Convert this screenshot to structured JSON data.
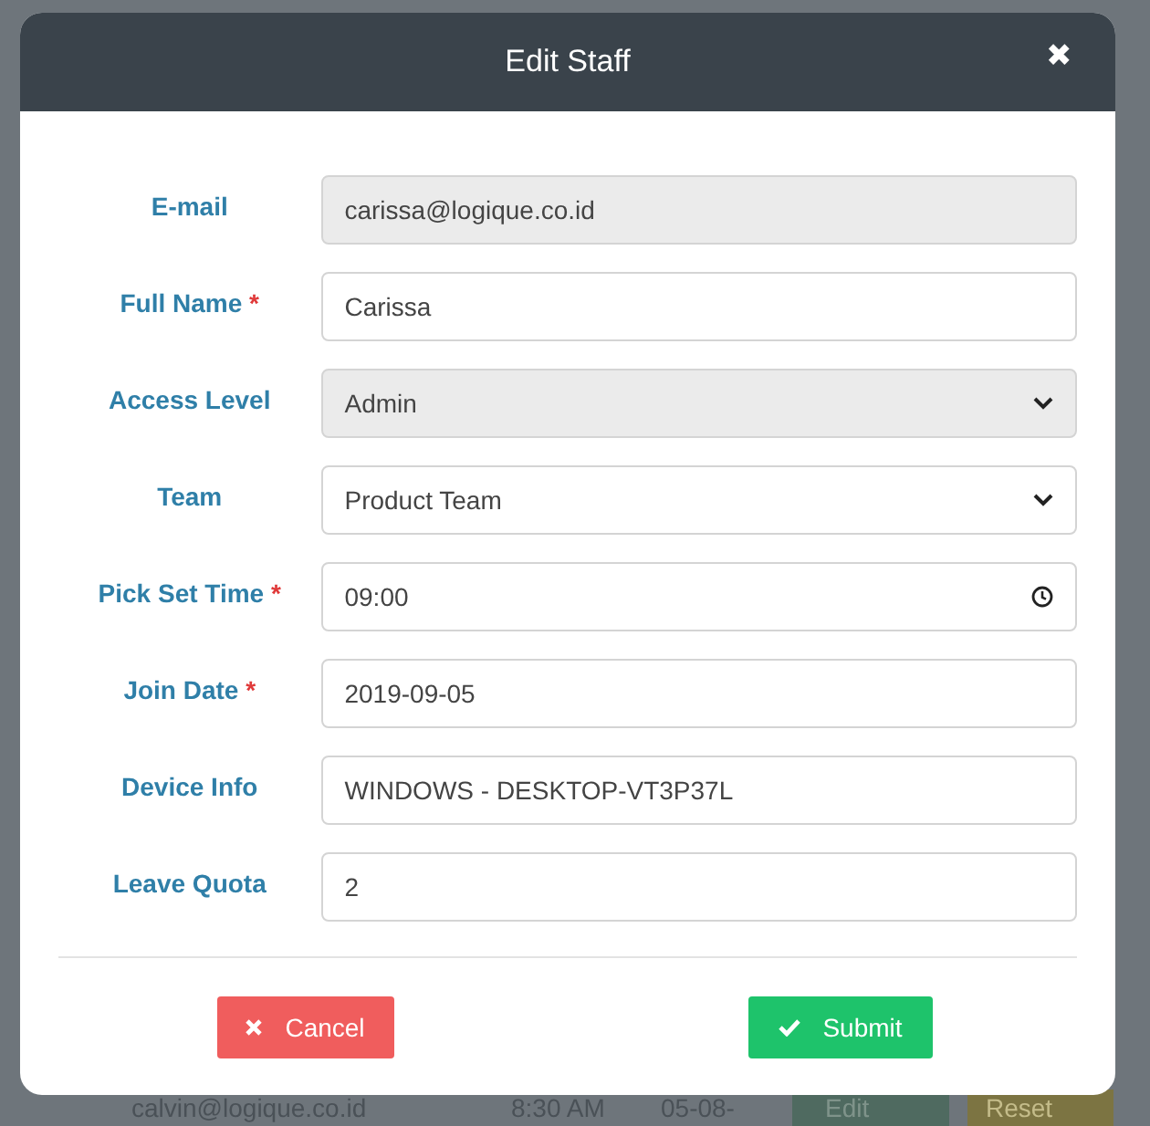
{
  "background_row": {
    "email": "calvin@logique.co.id",
    "time": "8:30 AM",
    "date": "05-08-",
    "edit_button": "Edit",
    "reset_button": "Reset"
  },
  "dialog": {
    "title": "Edit Staff",
    "close": "✖",
    "required_mark": "*",
    "fields": [
      {
        "label": "E-mail",
        "required": false,
        "kind": "text",
        "value": "carissa@logique.co.id",
        "disabled": true
      },
      {
        "label": "Full Name",
        "required": true,
        "kind": "text",
        "value": "Carissa",
        "disabled": false
      },
      {
        "label": "Access Level",
        "required": false,
        "kind": "select",
        "value": "Admin",
        "disabled": true
      },
      {
        "label": "Team",
        "required": false,
        "kind": "select",
        "value": "Product Team",
        "disabled": false
      },
      {
        "label": "Pick Set Time",
        "required": true,
        "kind": "time",
        "value": "09:00",
        "disabled": false
      },
      {
        "label": "Join Date",
        "required": true,
        "kind": "text",
        "value": "2019-09-05",
        "disabled": false
      },
      {
        "label": "Device Info",
        "required": false,
        "kind": "text",
        "value": "WINDOWS - DESKTOP-VT3P37L",
        "disabled": false
      },
      {
        "label": "Leave Quota",
        "required": false,
        "kind": "text",
        "value": "2",
        "disabled": false
      }
    ],
    "buttons": [
      {
        "kind": "cancel",
        "label": "Cancel"
      },
      {
        "kind": "submit",
        "label": "Submit"
      }
    ]
  }
}
